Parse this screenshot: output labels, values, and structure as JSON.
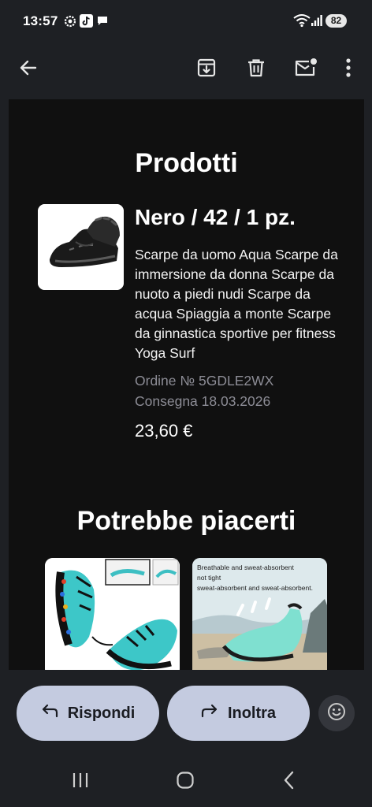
{
  "status_bar": {
    "time": "13:57",
    "battery": "82",
    "icons": [
      "settings-icon",
      "tiktok-icon",
      "chat-bubble-icon",
      "wifi-icon",
      "signal-icon"
    ]
  },
  "toolbar": {
    "icons": [
      "back-arrow-icon",
      "archive-icon",
      "delete-icon",
      "mark-unread-icon",
      "more-vert-icon"
    ]
  },
  "email": {
    "section_products": "Prodotti",
    "product": {
      "variant": "Nero / 42 / 1 pz.",
      "description": "Scarpe da uomo Aqua Scarpe da immersione da donna Scarpe da nuoto a piedi nudi Scarpe da acqua Spiaggia a monte Scarpe da ginnastica sportive per fitness Yoga Surf",
      "order": "Ordine № 5GDLE2WX",
      "delivery": "Consegna 18.03.2026",
      "price": "23,60 €"
    },
    "section_recommend": "Potrebbe piacerti",
    "recommendations": [
      {
        "caption_lines": []
      },
      {
        "caption_lines": [
          "Breathable and sweat-absorbent",
          "not tight",
          "sweat-absorbent and sweat-absorbent."
        ]
      }
    ]
  },
  "actions": {
    "reply": "Rispondi",
    "forward": "Inoltra",
    "emoji_icon": "emoji-icon"
  },
  "nav": {
    "icons": [
      "recent-apps-icon",
      "home-icon",
      "back-icon"
    ]
  },
  "colors": {
    "background": "#1e2024",
    "email_bg": "#101010",
    "pill": "#c4cbe0",
    "meta_text": "#8d8d96"
  }
}
